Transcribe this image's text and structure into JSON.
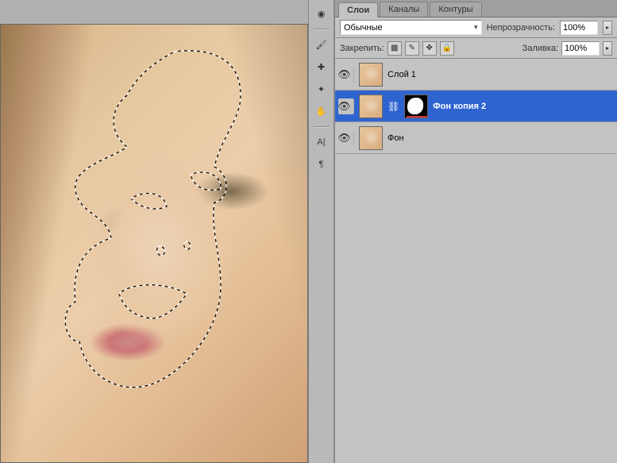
{
  "tabs": {
    "layers": "Слои",
    "channels": "Каналы",
    "paths": "Контуры"
  },
  "blend_mode": "Обычные",
  "opacity": {
    "label": "Непрозрачность:",
    "value": "100%"
  },
  "fill": {
    "label": "Заливка:",
    "value": "100%"
  },
  "lock_label": "Закрепить:",
  "layers_list": [
    {
      "name": "Слой 1"
    },
    {
      "name": "Фон копия 2"
    },
    {
      "name": "Фон"
    }
  ],
  "vt": {
    "expose": "◉",
    "brush": "🖌",
    "healing": "✚",
    "patch": "✦",
    "hand": "✋",
    "text_a": "A|",
    "pilcrow": "¶"
  },
  "lock_icons": {
    "trans": "▩",
    "pixels": "✎",
    "pos": "✥",
    "all": "🔒"
  }
}
